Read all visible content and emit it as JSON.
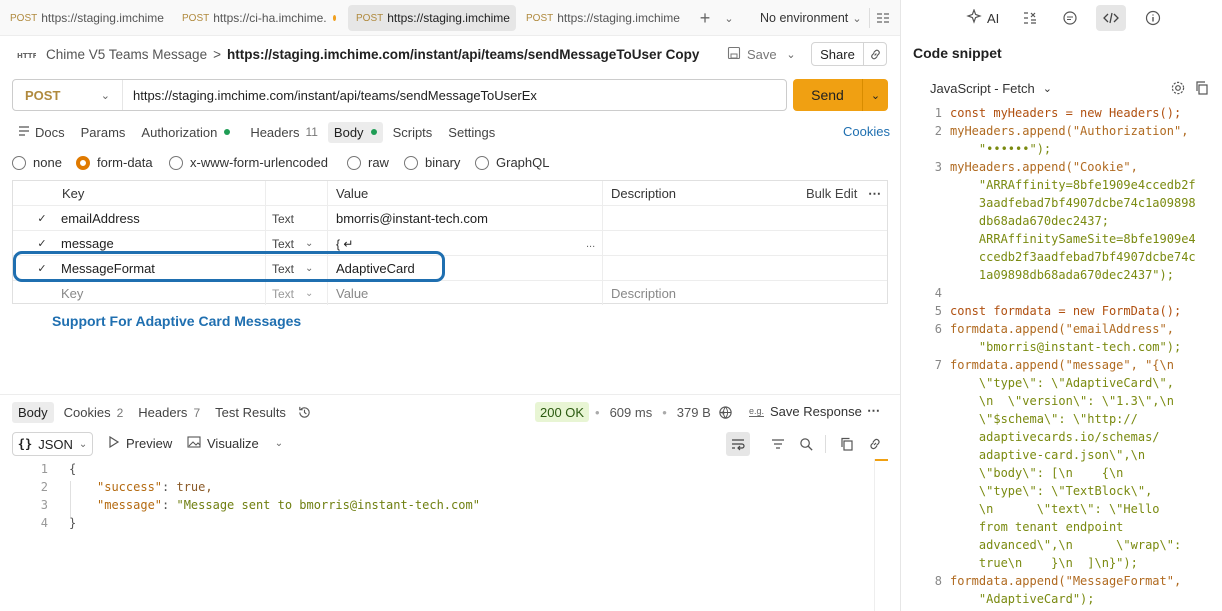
{
  "tabs": [
    {
      "method": "POST",
      "url": "https://staging.imchime"
    },
    {
      "method": "POST",
      "url": "https://ci-ha.imchime."
    },
    {
      "method": "POST",
      "url": "https://staging.imchime"
    },
    {
      "method": "POST",
      "url": "https://staging.imchime"
    }
  ],
  "env": {
    "label": "No environment"
  },
  "right_top": {
    "ai": "AI"
  },
  "breadcrumb": {
    "collection": "Chime V5 Teams Message",
    "separator": ">",
    "name": "https://staging.imchime.com/instant/api/teams/sendMessageToUser Copy",
    "save": "Save",
    "share": "Share"
  },
  "request": {
    "method": "POST",
    "url": "https://staging.imchime.com/instant/api/teams/sendMessageToUserEx",
    "send": "Send"
  },
  "req_tabs": {
    "docs": "Docs",
    "params": "Params",
    "authorization": "Authorization",
    "headers": "Headers",
    "headers_count": "11",
    "body": "Body",
    "scripts": "Scripts",
    "settings": "Settings",
    "cookies": "Cookies"
  },
  "body_types": [
    "none",
    "form-data",
    "x-www-form-urlencoded",
    "raw",
    "binary",
    "GraphQL"
  ],
  "table": {
    "headers": {
      "key": "Key",
      "value": "Value",
      "description": "Description",
      "bulk": "Bulk Edit"
    },
    "rows": [
      {
        "key": "emailAddress",
        "type": "Text",
        "value": "bmorris@instant-tech.com"
      },
      {
        "key": "message",
        "type": "Text",
        "value": "{ ↵",
        "more": "..."
      },
      {
        "key": "MessageFormat",
        "type": "Text",
        "value": "AdaptiveCard"
      }
    ],
    "placeholder": {
      "key": "Key",
      "type": "Text",
      "value": "Value",
      "description": "Description"
    }
  },
  "annotation": "Support For Adaptive Card Messages",
  "response": {
    "tabs": {
      "body": "Body",
      "cookies": "Cookies",
      "cookies_count": "2",
      "headers": "Headers",
      "headers_count": "7",
      "tests": "Test Results"
    },
    "status": "200 OK",
    "time": "609 ms",
    "size": "379 B",
    "save": "Save Response",
    "format": "JSON",
    "preview": "Preview",
    "visualize": "Visualize",
    "lines": [
      {
        "n": "1",
        "text": "{"
      },
      {
        "n": "2",
        "k": "\"success\"",
        "v": "true,"
      },
      {
        "n": "3",
        "k": "\"message\"",
        "v": "\"Message sent to bmorris@instant-tech.com\""
      },
      {
        "n": "4",
        "text": "}"
      }
    ]
  },
  "snippet": {
    "title": "Code snippet",
    "language": "JavaScript - Fetch",
    "lines": [
      {
        "n": "1",
        "t": "const myHeaders = new Headers();"
      },
      {
        "n": "2",
        "t": "myHeaders.append(\"Authorization\","
      },
      {
        "n": "",
        "t": "    \"••••••\");"
      },
      {
        "n": "3",
        "t": "myHeaders.append(\"Cookie\","
      },
      {
        "n": "",
        "t": "    \"ARRAffinity=8bfe1909e4ccedb2f"
      },
      {
        "n": "",
        "t": "    3aadfebad7bf4907dcbe74c1a09898"
      },
      {
        "n": "",
        "t": "    db68ada670dec2437;"
      },
      {
        "n": "",
        "t": "    ARRAffinitySameSite=8bfe1909e4"
      },
      {
        "n": "",
        "t": "    ccedb2f3aadfebad7bf4907dcbe74c"
      },
      {
        "n": "",
        "t": "    1a09898db68ada670dec2437\");"
      },
      {
        "n": "4",
        "t": ""
      },
      {
        "n": "5",
        "t": "const formdata = new FormData();"
      },
      {
        "n": "6",
        "t": "formdata.append(\"emailAddress\","
      },
      {
        "n": "",
        "t": "    \"bmorris@instant-tech.com\");"
      },
      {
        "n": "7",
        "t": "formdata.append(\"message\", \"{\\n"
      },
      {
        "n": "",
        "t": "    \\\"type\\\": \\\"AdaptiveCard\\\","
      },
      {
        "n": "",
        "t": "    \\n  \\\"version\\\": \\\"1.3\\\",\\n"
      },
      {
        "n": "",
        "t": "    \\\"$schema\\\": \\\"http://"
      },
      {
        "n": "",
        "t": "    adaptivecards.io/schemas/"
      },
      {
        "n": "",
        "t": "    adaptive-card.json\\\",\\n"
      },
      {
        "n": "",
        "t": "    \\\"body\\\": [\\n    {\\n"
      },
      {
        "n": "",
        "t": "    \\\"type\\\": \\\"TextBlock\\\","
      },
      {
        "n": "",
        "t": "    \\n      \\\"text\\\": \\\"Hello"
      },
      {
        "n": "",
        "t": "    from tenant endpoint"
      },
      {
        "n": "",
        "t": "    advanced\\\",\\n      \\\"wrap\\\":"
      },
      {
        "n": "",
        "t": "    true\\n    }\\n  ]\\n}\");"
      },
      {
        "n": "8",
        "t": "formdata.append(\"MessageFormat\","
      },
      {
        "n": "",
        "t": "    \"AdaptiveCard\");"
      }
    ]
  },
  "colors": {
    "accent": "#f0a012",
    "method": "#b08a3e",
    "highlight": "#1f6fb0",
    "status_bg": "#e8f5d4"
  }
}
